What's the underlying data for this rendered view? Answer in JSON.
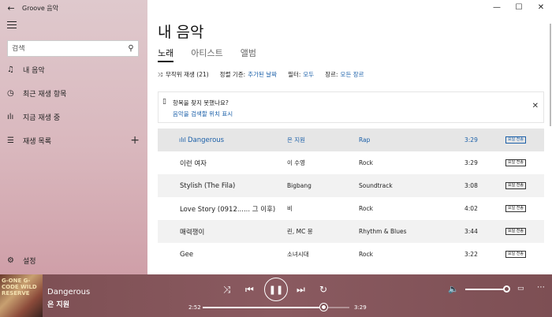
{
  "app": {
    "title": "Groove 음악"
  },
  "sidebar": {
    "search_placeholder": "검색",
    "items": [
      {
        "label": "내 음악",
        "icon": "music-note-icon"
      },
      {
        "label": "최근 재생 항목",
        "icon": "clock-icon"
      },
      {
        "label": "지금 재생 중",
        "icon": "bars-icon"
      },
      {
        "label": "재생 목록",
        "icon": "playlist-icon"
      }
    ],
    "settings_label": "설정"
  },
  "main": {
    "title": "내 음악",
    "tabs": [
      {
        "label": "노래",
        "active": true
      },
      {
        "label": "아티스트",
        "active": false
      },
      {
        "label": "앨범",
        "active": false
      }
    ],
    "toolbar": {
      "shuffle_label": "무작위 재생 (21)",
      "sort_prefix": "정렬 기준:",
      "sort_value": "추가된 날짜",
      "filter_prefix": "필터:",
      "filter_value": "모두",
      "genre_prefix": "장르:",
      "genre_value": "모든 장르"
    },
    "notice": {
      "line1": "항목을 찾지 못했나요?",
      "line2": "음악을 검색할 위치 표시"
    },
    "songs": [
      {
        "title": "Dangerous",
        "artist": "은 지원",
        "genre": "Rap",
        "duration": "3:29",
        "badge": "요일 전송",
        "playing": true
      },
      {
        "title": "이런 여자",
        "artist": "이 수영",
        "genre": "Rock",
        "duration": "3:29",
        "badge": "요일 전송",
        "playing": false
      },
      {
        "title": "Stylish (The Fila)",
        "artist": "Bigbang",
        "genre": "Soundtrack",
        "duration": "3:08",
        "badge": "요일 전송",
        "playing": false
      },
      {
        "title": "Love Story (0912...... 그 이후)",
        "artist": "비",
        "genre": "Rock",
        "duration": "4:02",
        "badge": "요일 전송",
        "playing": false
      },
      {
        "title": "매력쟁이",
        "artist": "린, MC 몽",
        "genre": "Rhythm & Blues",
        "duration": "3:44",
        "badge": "요일 전송",
        "playing": false
      },
      {
        "title": "Gee",
        "artist": "소녀시대",
        "genre": "Rock",
        "duration": "3:22",
        "badge": "요일 전송",
        "playing": false
      }
    ]
  },
  "player": {
    "album_art_text": "G-ONE G-CODE WILD RESERVE",
    "now_title": "Dangerous",
    "now_artist": "은 지원",
    "elapsed": "2:52",
    "total": "3:29",
    "progress_fraction": 0.82,
    "volume_fraction": 0.9
  },
  "colors": {
    "accent": "#1a5fa8",
    "player_bg": "#7c4e52",
    "sidebar_bg": "#d9b7bd"
  }
}
